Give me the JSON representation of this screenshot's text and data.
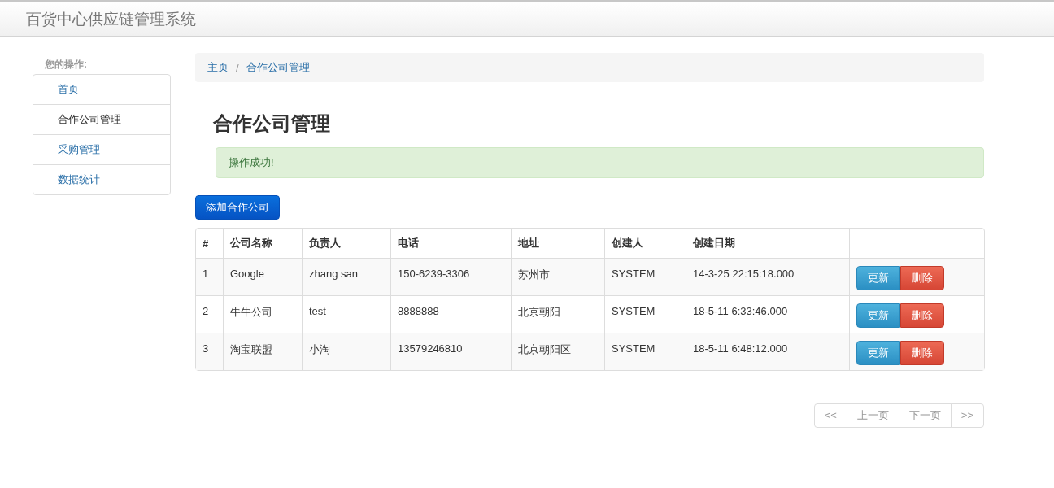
{
  "navbar": {
    "brand": "百货中心供应链管理系统"
  },
  "sidebar": {
    "heading": "您的操作:",
    "items": [
      {
        "label": "首页",
        "selected": false
      },
      {
        "label": "合作公司管理",
        "selected": true
      },
      {
        "label": "采购管理",
        "selected": false
      },
      {
        "label": "数据统计",
        "selected": false
      }
    ]
  },
  "breadcrumb": {
    "separator": "/",
    "items": [
      "主页",
      "合作公司管理"
    ]
  },
  "page_title": "合作公司管理",
  "alert": "操作成功!",
  "add_button": "添加合作公司",
  "table": {
    "columns": [
      "#",
      "公司名称",
      "负责人",
      "电话",
      "地址",
      "创建人",
      "创建日期",
      ""
    ],
    "rows": [
      {
        "cells": [
          "1",
          "Google",
          "zhang san",
          "150-6239-3306",
          "苏州市",
          "SYSTEM",
          "14-3-25 22:15:18.000"
        ],
        "actions": [
          "更新",
          "删除"
        ]
      },
      {
        "cells": [
          "2",
          "牛牛公司",
          "test",
          "8888888",
          "北京朝阳",
          "SYSTEM",
          "18-5-11 6:33:46.000"
        ],
        "actions": [
          "更新",
          "删除"
        ]
      },
      {
        "cells": [
          "3",
          "淘宝联盟",
          "小淘",
          "13579246810",
          "北京朝阳区",
          "SYSTEM",
          "18-5-11 6:48:12.000"
        ],
        "actions": [
          "更新",
          "删除"
        ]
      }
    ]
  },
  "pagination": [
    {
      "label": "<<",
      "disabled": true
    },
    {
      "label": "上一页",
      "disabled": true
    },
    {
      "label": "下一页",
      "disabled": true
    },
    {
      "label": ">>",
      "disabled": true
    }
  ]
}
